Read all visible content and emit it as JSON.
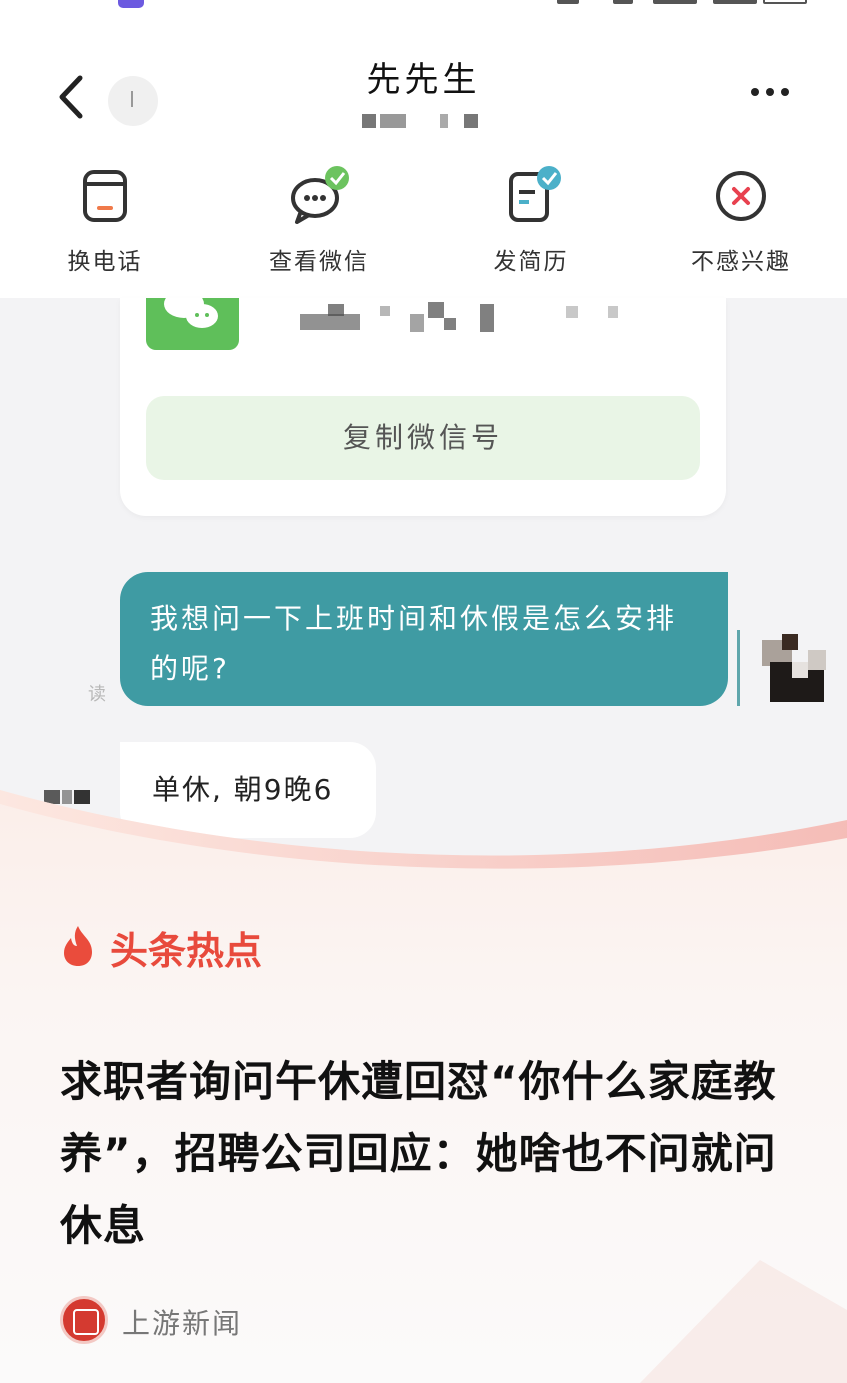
{
  "header": {
    "title": "先先生",
    "actions": [
      {
        "label": "换电话",
        "icon": "phone-card-icon"
      },
      {
        "label": "查看微信",
        "icon": "wechat-icon"
      },
      {
        "label": "发简历",
        "icon": "resume-icon"
      },
      {
        "label": "不感兴趣",
        "icon": "close-circle-icon"
      }
    ]
  },
  "chat": {
    "copy_wechat_label": "复制微信号",
    "my_message": "我想问一下上班时间和休假是怎么安排的呢?",
    "read_status": "读",
    "reply_message": "单休, 朝9晚6"
  },
  "news": {
    "tag": "头条热点",
    "headline": "求职者询问午休遭回怼“你什么家庭教养”，招聘公司回应：她啥也不问就问休息",
    "source": "上游新闻"
  },
  "colors": {
    "bubble_me": "#3f9ba3",
    "wechat_green": "#5fbf5a",
    "hot_red": "#e84a3c",
    "check_green": "#6cc35f",
    "check_teal": "#4bb0c9"
  }
}
